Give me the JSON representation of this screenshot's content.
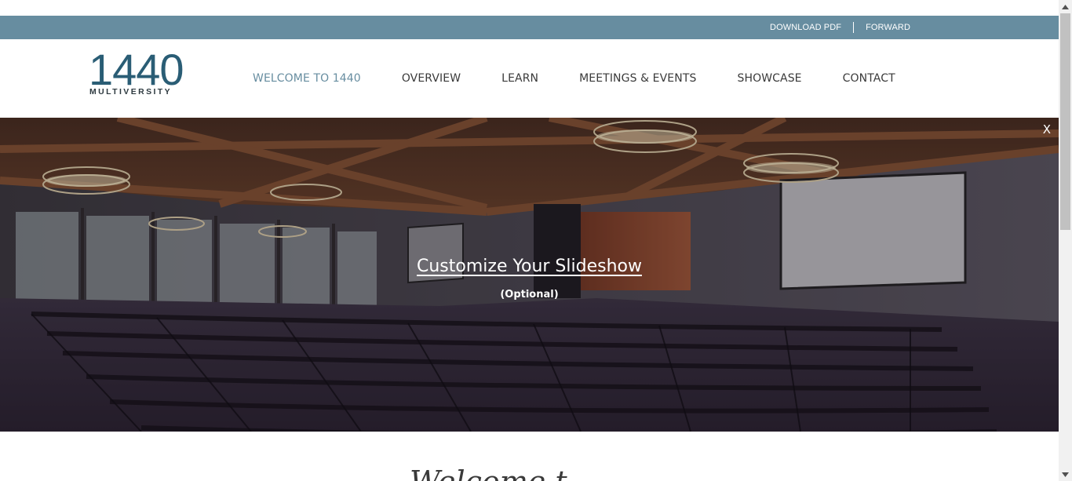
{
  "utility": {
    "download_pdf": "DOWNLOAD PDF",
    "forward": "FORWARD"
  },
  "logo": {
    "number": "1440",
    "word": "MULTIVERSITY",
    "color": "#2a5d75"
  },
  "nav": {
    "items": [
      {
        "label": "WELCOME TO 1440",
        "active": true
      },
      {
        "label": "OVERVIEW"
      },
      {
        "label": "LEARN"
      },
      {
        "label": "MEETINGS & EVENTS"
      },
      {
        "label": "SHOWCASE"
      },
      {
        "label": "CONTACT"
      }
    ]
  },
  "hero": {
    "close_label": "X",
    "title": "Customize Your Slideshow",
    "subtitle": "(Optional)"
  },
  "content": {
    "heading_partial": "Welcome t"
  },
  "colors": {
    "utility_bar": "#678da0",
    "nav_active": "#678da0",
    "nav_text": "#3a3a3a"
  }
}
